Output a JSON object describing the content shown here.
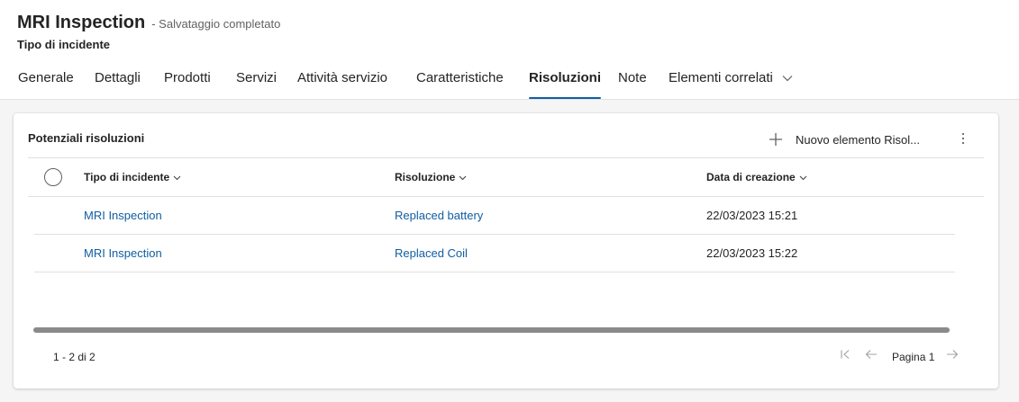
{
  "header": {
    "title": "MRI Inspection",
    "save_status": "- Salvataggio completato",
    "entity_type": "Tipo di incidente"
  },
  "tabs": [
    {
      "label": "Generale",
      "active": false
    },
    {
      "label": "Dettagli",
      "active": false
    },
    {
      "label": "Prodotti",
      "active": false
    },
    {
      "label": "Servizi",
      "active": false
    },
    {
      "label": "Attività servizio",
      "active": false
    },
    {
      "label": "Caratteristiche",
      "active": false
    },
    {
      "label": "Risoluzioni",
      "active": true
    },
    {
      "label": "Note",
      "active": false
    },
    {
      "label": "Elementi correlati",
      "active": false,
      "dropdown": true
    }
  ],
  "subgrid": {
    "title": "Potenziali risoluzioni",
    "new_button_label": "Nuovo elemento Risol...",
    "columns": [
      "Tipo di incidente",
      "Risoluzione",
      "Data di creazione"
    ],
    "rows": [
      {
        "incident_type": "MRI Inspection",
        "resolution": "Replaced battery",
        "created_on": "22/03/2023 15:21"
      },
      {
        "incident_type": "MRI Inspection",
        "resolution": "Replaced Coil",
        "created_on": "22/03/2023 15:22"
      }
    ],
    "record_count": "1 - 2 di 2",
    "page_label": "Pagina 1"
  },
  "colors": {
    "accent": "#115ea3",
    "text": "#242424",
    "muted": "#616161",
    "divider": "#e0e0e0"
  },
  "icons": [
    "chevron-down-icon",
    "plus-icon",
    "more-vertical-icon",
    "first-page-icon",
    "previous-page-icon",
    "next-page-icon"
  ]
}
